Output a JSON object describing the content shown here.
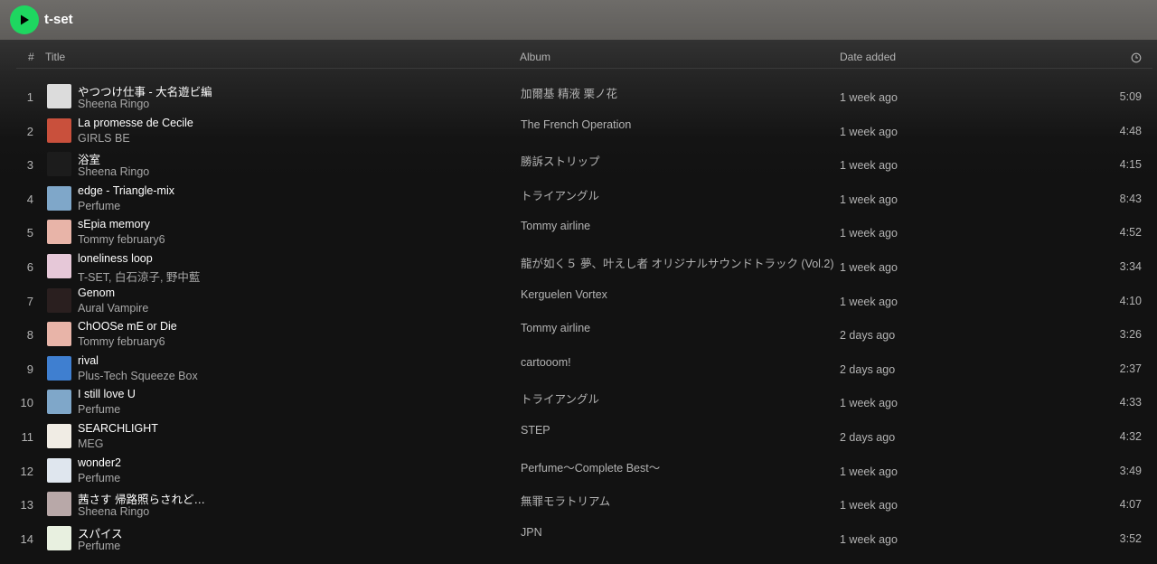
{
  "playlist": {
    "title": "t-set"
  },
  "colors": {
    "accent": "#1ed760",
    "topbar": "#6e6c69",
    "background": "#121212"
  },
  "header": {
    "number": "#",
    "title": "Title",
    "album": "Album",
    "date_added": "Date added",
    "duration_icon": "clock-icon"
  },
  "tracks": [
    {
      "number": "1",
      "title": "やつつけ仕事 - 大名遊ビ編",
      "artist": "Sheena Ringo",
      "album": "加爾基 精液 栗ノ花",
      "added": "1 week ago",
      "duration": "5:09",
      "cover_color": "#dcdcdc"
    },
    {
      "number": "2",
      "title": "La promesse de Cecile",
      "artist": "GIRLS BE",
      "album": "The French Operation",
      "added": "1 week ago",
      "duration": "4:48",
      "cover_color": "#c9503c"
    },
    {
      "number": "3",
      "title": "浴室",
      "artist": "Sheena Ringo",
      "album": "勝訴ストリップ",
      "added": "1 week ago",
      "duration": "4:15",
      "cover_color": "#1c1c1c"
    },
    {
      "number": "4",
      "title": "edge - Triangle-mix",
      "artist": "Perfume",
      "album": "トライアングル",
      "added": "1 week ago",
      "duration": "8:43",
      "cover_color": "#7fa7c9"
    },
    {
      "number": "5",
      "title": "sEpia memory",
      "artist": "Tommy february6",
      "album": "Tommy airline",
      "added": "1 week ago",
      "duration": "4:52",
      "cover_color": "#e8b4a8"
    },
    {
      "number": "6",
      "title": "loneliness loop",
      "artist": "T-SET, 白石涼子, 野中藍",
      "album": "龍が如く５ 夢、叶えし者 オリジナルサウンドトラック (Vol.2)",
      "added": "1 week ago",
      "duration": "3:34",
      "cover_color": "#e6c8d8"
    },
    {
      "number": "7",
      "title": "Genom",
      "artist": "Aural Vampire",
      "album": "Kerguelen Vortex",
      "added": "1 week ago",
      "duration": "4:10",
      "cover_color": "#2a1f1f"
    },
    {
      "number": "8",
      "title": "ChOOSe mE or Die",
      "artist": "Tommy february6",
      "album": "Tommy airline",
      "added": "2 days ago",
      "duration": "3:26",
      "cover_color": "#e8b4a8"
    },
    {
      "number": "9",
      "title": "rival",
      "artist": "Plus-Tech Squeeze Box",
      "album": "cartooom!",
      "added": "2 days ago",
      "duration": "2:37",
      "cover_color": "#3f7fd0"
    },
    {
      "number": "10",
      "title": "I still love U",
      "artist": "Perfume",
      "album": "トライアングル",
      "added": "1 week ago",
      "duration": "4:33",
      "cover_color": "#7fa7c9"
    },
    {
      "number": "11",
      "title": "SEARCHLIGHT",
      "artist": "MEG",
      "album": "STEP",
      "added": "2 days ago",
      "duration": "4:32",
      "cover_color": "#f0ece4"
    },
    {
      "number": "12",
      "title": "wonder2",
      "artist": "Perfume",
      "album": "Perfume〜Complete Best〜",
      "added": "1 week ago",
      "duration": "3:49",
      "cover_color": "#dfe6ee"
    },
    {
      "number": "13",
      "title": "茜さす 帰路照らされど…",
      "artist": "Sheena Ringo",
      "album": "無罪モラトリアム",
      "added": "1 week ago",
      "duration": "4:07",
      "cover_color": "#b8a8a8"
    },
    {
      "number": "14",
      "title": "スパイス",
      "artist": "Perfume",
      "album": "JPN",
      "added": "1 week ago",
      "duration": "3:52",
      "cover_color": "#e8f0e0"
    }
  ]
}
